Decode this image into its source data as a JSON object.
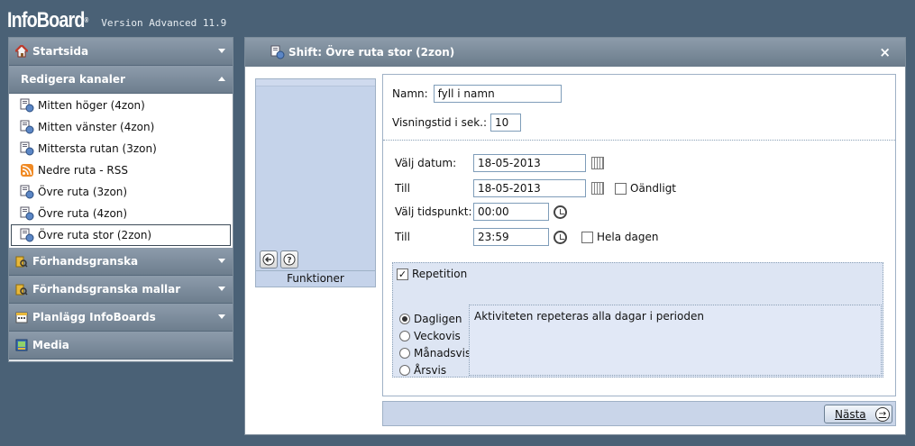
{
  "header": {
    "logo": "InfoBoard",
    "logo_mark": "®",
    "version": "Version Advanced 11.9"
  },
  "sidebar": {
    "sections": [
      {
        "label": "Startsida",
        "icon": "home-icon",
        "expanded": false
      },
      {
        "label": "Redigera kanaler",
        "icon": "",
        "expanded": true
      },
      {
        "label": "Förhandsgranska",
        "icon": "folder-preview-icon",
        "expanded": false
      },
      {
        "label": "Förhandsgranska mallar",
        "icon": "folder-preview-icon",
        "expanded": false
      },
      {
        "label": "Planlägg InfoBoards",
        "icon": "calendar-icon",
        "expanded": false
      },
      {
        "label": "Media",
        "icon": "media-icon",
        "expanded": false
      }
    ],
    "channels": [
      {
        "label": "Mitten höger (4zon)",
        "icon": "channel-icon",
        "selected": false
      },
      {
        "label": "Mitten vänster (4zon)",
        "icon": "channel-icon",
        "selected": false
      },
      {
        "label": "Mittersta rutan (3zon)",
        "icon": "channel-icon",
        "selected": false
      },
      {
        "label": "Nedre ruta - RSS",
        "icon": "rss-icon",
        "selected": false
      },
      {
        "label": "Övre ruta (3zon)",
        "icon": "channel-icon",
        "selected": false
      },
      {
        "label": "Övre ruta (4zon)",
        "icon": "channel-icon",
        "selected": false
      },
      {
        "label": "Övre ruta stor (2zon)",
        "icon": "channel-icon",
        "selected": true
      }
    ]
  },
  "panel": {
    "title": "Shift: Övre ruta stor (2zon)",
    "close": "×",
    "functions_label": "Funktioner",
    "back_icon": "back-arrow-icon",
    "help_icon": "help-icon"
  },
  "form": {
    "name_label": "Namn:",
    "name_value": "fyll i namn",
    "duration_label": "Visningstid i sek.:",
    "duration_value": "10",
    "date_label": "Välj datum:",
    "date_value": "18-05-2013",
    "date_to_label": "Till",
    "date_to_value": "18-05-2013",
    "infinite_label": "Oändligt",
    "infinite_checked": false,
    "time_label": "Välj tidspunkt:",
    "time_value": "00:00",
    "time_to_label": "Till",
    "time_to_value": "23:59",
    "allday_label": "Hela dagen",
    "allday_checked": false,
    "repetition_label": "Repetition",
    "repetition_checked": true,
    "check_mark": "✓",
    "options": [
      {
        "label": "Dagligen",
        "selected": true
      },
      {
        "label": "Veckovis",
        "selected": false
      },
      {
        "label": "Månadsvis",
        "selected": false
      },
      {
        "label": "Årsvis",
        "selected": false
      }
    ],
    "description": "Aktiviteten repeteras alla dagar i perioden"
  },
  "footer": {
    "next_label": "Nästa",
    "next_arrow": "→"
  },
  "colors": {
    "background": "#4a6176",
    "header_bar": "#7d8d9b",
    "panel_blue": "#c5d3ea"
  }
}
